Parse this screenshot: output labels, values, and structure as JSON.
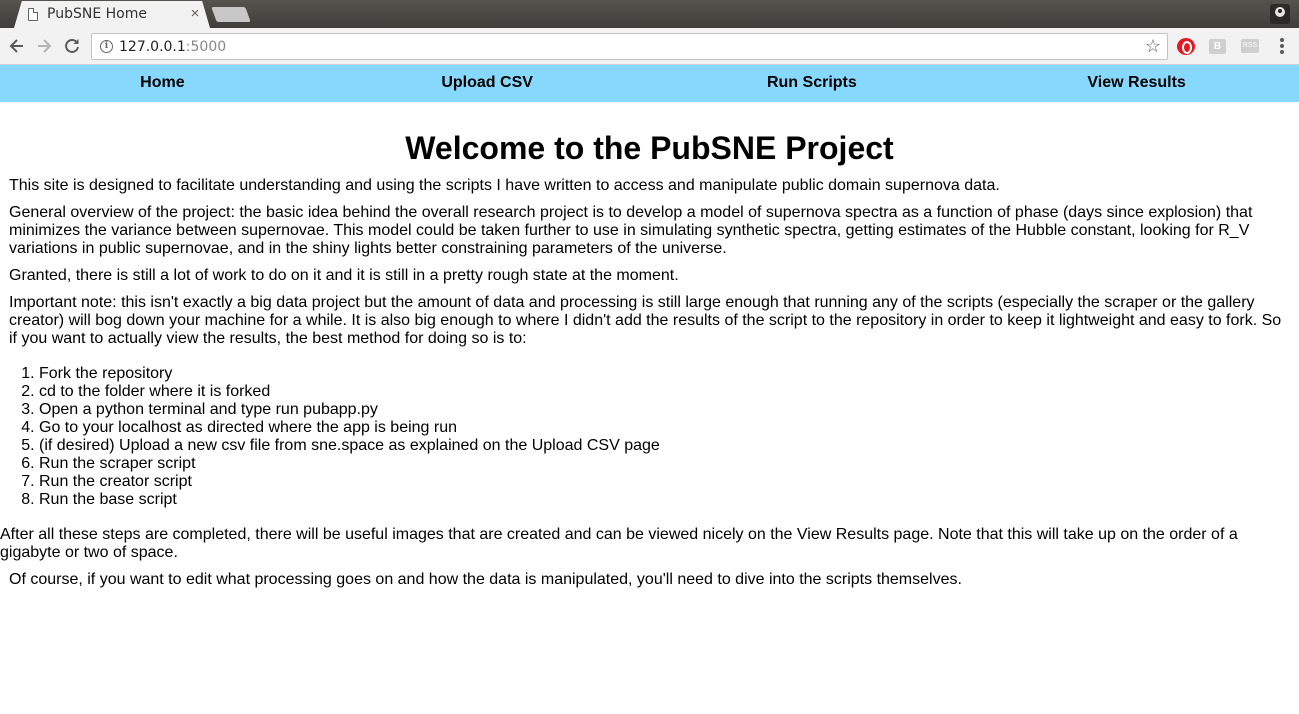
{
  "browser": {
    "tab_title": "PubSNE Home",
    "tab_close": "×",
    "url_host": "127.0.0.1",
    "url_port": ":5000",
    "ext_b_label": "B",
    "ext_ss_label": "RSS"
  },
  "nav": {
    "items": [
      {
        "label": "Home"
      },
      {
        "label": "Upload CSV"
      },
      {
        "label": "Run Scripts"
      },
      {
        "label": "View Results"
      }
    ]
  },
  "page": {
    "heading": "Welcome to the PubSNE Project",
    "intro": "This site is designed to facilitate understanding and using the scripts I have written to access and manipulate public domain supernova data.",
    "overview": "General overview of the project: the basic idea behind the overall research project is to develop a model of supernova spectra as a function of phase (days since explosion) that minimizes the variance between supernovae. This model could be taken further to use in simulating synthetic spectra, getting estimates of the Hubble constant, looking for R_V variations in public supernovae, and in the shiny lights better constraining parameters of the universe.",
    "granted": "Granted, there is still a lot of work to do on it and it is still in a pretty rough state at the moment.",
    "note": "Important note: this isn't exactly a big data project but the amount of data and processing is still large enough that running any of the scripts (especially the scraper or the gallery creator) will bog down your machine for a while. It is also big enough to where I didn't add the results of the script to the repository in order to keep it lightweight and easy to fork. So if you want to actually view the results, the best method for doing so is to:",
    "steps": [
      "Fork the repository",
      "cd to the folder where it is forked",
      "Open a python terminal and type run pubapp.py",
      "Go to your localhost as directed where the app is being run",
      "(if desired) Upload a new csv file from sne.space as explained on the Upload CSV page",
      "Run the scraper script",
      "Run the creator script",
      "Run the base script"
    ],
    "after_steps": "After all these steps are completed, there will be useful images that are created and can be viewed nicely on the View Results page. Note that this will take up on the order of a gigabyte or two of space.",
    "closing": "Of course, if you want to edit what processing goes on and how the data is manipulated, you'll need to dive into the scripts themselves."
  }
}
